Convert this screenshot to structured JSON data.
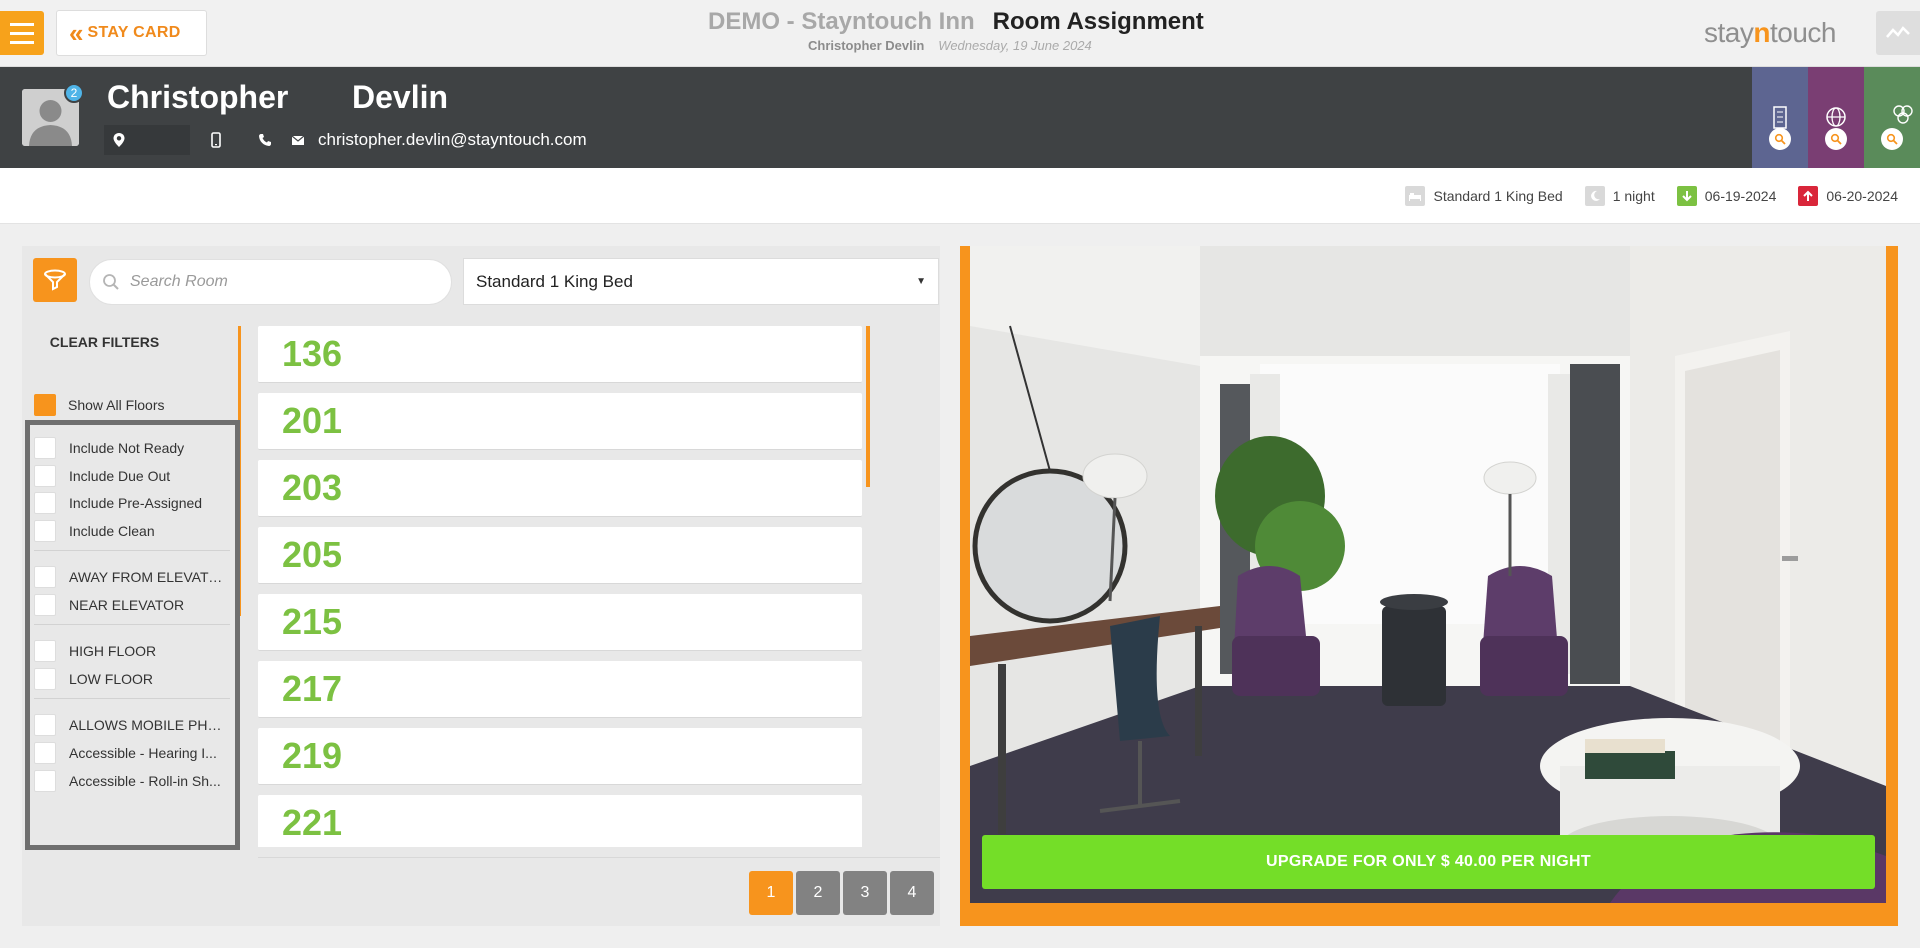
{
  "header": {
    "back_label": "STAY CARD",
    "hotel_name": "DEMO - Stayntouch Inn",
    "page_title": "Room Assignment",
    "guest_name": "Christopher Devlin",
    "date": "Wednesday, 19 June 2024",
    "logo_prefix": "stay",
    "logo_accent": "n",
    "logo_suffix": "touch"
  },
  "guest": {
    "first_name": "Christopher",
    "last_name": "Devlin",
    "badge_count": "2",
    "email": "christopher.devlin@stayntouch.com"
  },
  "summary": {
    "room_type": "Standard 1 King Bed",
    "nights": "1 night",
    "arrival": "06-19-2024",
    "departure": "06-20-2024"
  },
  "filters": {
    "search_placeholder": "Search Room",
    "room_type_selected": "Standard 1 King Bed",
    "clear_label": "CLEAR FILTERS",
    "show_all_floors": "Show All Floors",
    "options": [
      "Include Not Ready",
      "Include Due Out",
      "Include Pre-Assigned",
      "Include Clean",
      "AWAY FROM ELEVATOR",
      "NEAR ELEVATOR",
      "HIGH FLOOR",
      "LOW FLOOR",
      "ALLOWS MOBILE PHO...",
      "Accessible - Hearing I...",
      "Accessible - Roll-in Sh..."
    ]
  },
  "rooms": [
    "136",
    "201",
    "203",
    "205",
    "215",
    "217",
    "219",
    "221"
  ],
  "pagination": [
    "1",
    "2",
    "3",
    "4"
  ],
  "upgrade": {
    "label": "UPGRADE FOR ONLY $ 40.00 PER NIGHT"
  },
  "colors": {
    "accent": "#f7941d",
    "room_number": "#7cc142",
    "upgrade": "#74de28",
    "guest_bar": "#3f4244",
    "arrival_icon": "#7cc142",
    "departure_icon": "#d9263a"
  }
}
